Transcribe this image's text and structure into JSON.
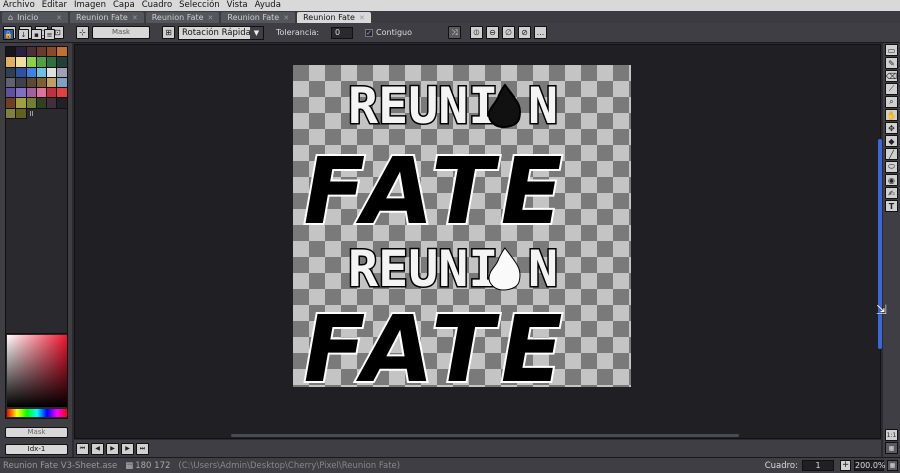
{
  "menu": [
    "Archivo",
    "Editar",
    "Imagen",
    "Capa",
    "Cuadro",
    "Selección",
    "Vista",
    "Ayuda"
  ],
  "tabs": [
    {
      "label": "Inicio",
      "active": false,
      "home": true
    },
    {
      "label": "Reunion Fate",
      "active": false
    },
    {
      "label": "Reunion Fate",
      "active": false
    },
    {
      "label": "Reunion Fate",
      "active": false
    },
    {
      "label": "Reunion Fate",
      "active": true
    }
  ],
  "context": {
    "mask_label": "Mask",
    "rotation_value": "Rotación Rápida",
    "tolerance_label": "Tolerancia:",
    "tolerance_value": "0",
    "contiguous_label": "Contiguo",
    "more_label": "..."
  },
  "palette": {
    "colors": [
      "#15151a",
      "#2a2040",
      "#4a2f38",
      "#6a3b2a",
      "#8a4a2a",
      "#c07030",
      "#e0b060",
      "#f0e0a0",
      "#90d040",
      "#50a040",
      "#307040",
      "#204038",
      "#304050",
      "#3050a0",
      "#4080e0",
      "#70c0e0",
      "#e0e0e0",
      "#a0a0b0",
      "#606070",
      "#40404a",
      "#5a4a30",
      "#806030",
      "#c0a060",
      "#80a0c0",
      "#6050a0",
      "#8070c0",
      "#a060a0",
      "#e070a0",
      "#c03040",
      "#e04040",
      "#704020",
      "#a0a040",
      "#708030",
      "#304020",
      "#40303a",
      "#202028",
      "#808040",
      "#606020"
    ],
    "extra_label": "II",
    "fgbg_label": "Mask",
    "index_label": "Idx-1"
  },
  "status": {
    "file": "Reunion Fate V3-Sheet.ase",
    "size": "180 172",
    "path": "(C:\\Users\\Admin\\Desktop\\Cherry\\Pixel\\Reunion Fate)",
    "frame_label": "Cuadro:",
    "frame_value": "1",
    "zoom_value": "200.0%"
  },
  "colors": {
    "accent": "#3a68d8",
    "panel": "#3e3e44",
    "canvas": "#1f1f24"
  }
}
